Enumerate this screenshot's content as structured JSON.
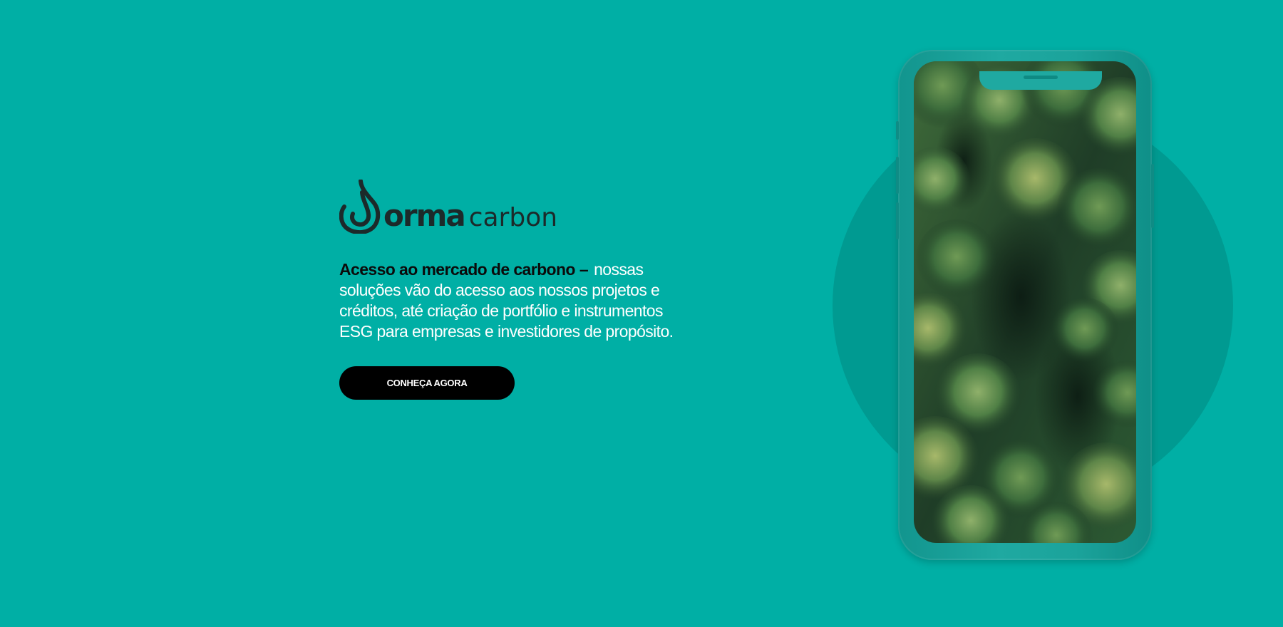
{
  "brand": {
    "name_primary": "orma",
    "name_secondary": "carbon"
  },
  "hero": {
    "headline_bold": "Acesso ao mercado de carbono",
    "separator": "–",
    "headline_text": "nossas soluções vão do acesso aos nossos projetos e créditos, até criação de portfólio e instrumentos ESG para empresas e investidores de propósito.",
    "cta_label": "CONHEÇA AGORA"
  },
  "visual": {
    "screen_image": "aerial-forest",
    "colors": {
      "background": "#00afa5",
      "circle": "#009a91",
      "phone_body": "#1ba39b",
      "cta_background": "#000000"
    }
  }
}
